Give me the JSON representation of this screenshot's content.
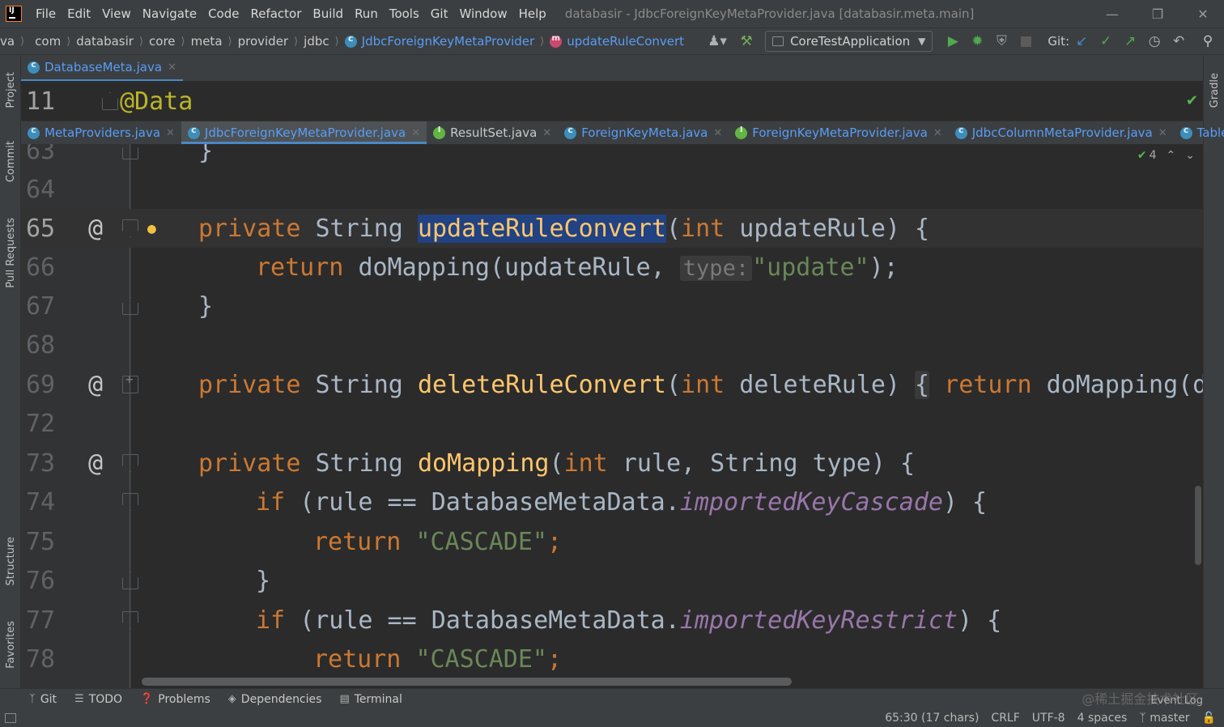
{
  "menubar": {
    "items": [
      "File",
      "Edit",
      "View",
      "Navigate",
      "Code",
      "Refactor",
      "Build",
      "Run",
      "Tools",
      "Git",
      "Window",
      "Help"
    ],
    "window_title": "databasir - JdbcForeignKeyMetaProvider.java [databasir.meta.main]"
  },
  "navbar": {
    "crumbs": [
      "va",
      "com",
      "databasir",
      "core",
      "meta",
      "provider",
      "jdbc"
    ],
    "class_crumb": "JdbcForeignKeyMetaProvider",
    "method_crumb": "updateRuleConvert",
    "run_config": "CoreTestApplication",
    "git_label": "Git:"
  },
  "pinned_tab": {
    "label": "DatabaseMeta.java"
  },
  "sticky": {
    "line_number": "11",
    "text": "@Data"
  },
  "tabs": [
    {
      "label": "MetaProviders.java",
      "icon": "class-icon"
    },
    {
      "label": "JdbcForeignKeyMetaProvider.java",
      "icon": "class-icon",
      "active": true
    },
    {
      "label": "ResultSet.java",
      "icon": "interface-icon"
    },
    {
      "label": "ForeignKeyMeta.java",
      "icon": "class-icon"
    },
    {
      "label": "ForeignKeyMetaProvider.java",
      "icon": "interface-icon"
    },
    {
      "label": "JdbcColumnMetaProvider.java",
      "icon": "class-icon"
    },
    {
      "label": "Table(",
      "icon": "class-icon"
    }
  ],
  "inspection": {
    "count": "4"
  },
  "editor": {
    "lines": [
      {
        "n": "63",
        "text": "}"
      },
      {
        "n": "64",
        "text": ""
      },
      {
        "n": "65",
        "kw": "private ",
        "type": "String ",
        "sel": "updateRuleConvert",
        "rest1": "(",
        "kw2": "int",
        "rest2": " updateRule) {"
      },
      {
        "n": "66",
        "kw": "return ",
        "rest1": "doMapping(updateRule, ",
        "hint": "type:",
        "str": "\"update\"",
        "rest2": ");"
      },
      {
        "n": "67",
        "text": "}"
      },
      {
        "n": "68",
        "text": ""
      },
      {
        "n": "69",
        "kw": "private ",
        "type": "String ",
        "fn": "deleteRuleConvert",
        "rest1": "(",
        "kw2": "int",
        "rest2": " deleteRule) ",
        "brace": "{",
        "kw3": " return ",
        "rest3": "doMapping(de"
      },
      {
        "n": "72",
        "text": ""
      },
      {
        "n": "73",
        "kw": "private ",
        "type": "String ",
        "fn": "doMapping",
        "rest1": "(",
        "kw2": "int",
        "rest2": " rule, String type) {"
      },
      {
        "n": "74",
        "kw": "if ",
        "rest1": "(rule == DatabaseMetaData.",
        "fld": "importedKeyCascade",
        "rest2": ") {"
      },
      {
        "n": "75",
        "kw": "return ",
        "str": "\"CASCADE\"",
        "rest2": ";"
      },
      {
        "n": "76",
        "text": "}"
      },
      {
        "n": "77",
        "kw": "if ",
        "rest1": "(rule == DatabaseMetaData.",
        "fld": "importedKeyRestrict",
        "rest2": ") {"
      },
      {
        "n": "78",
        "kw": "return ",
        "str": "\"CASCADE\"",
        "rest2": ";"
      }
    ]
  },
  "tool_tabs": [
    "Git",
    "TODO",
    "Problems",
    "Dependencies",
    "Terminal"
  ],
  "left_stripe": [
    "Project",
    "Commit",
    "Pull Requests",
    "Structure",
    "Favorites"
  ],
  "right_stripe": [
    "Gradle"
  ],
  "status": {
    "position": "65:30 (17 chars)",
    "line_sep": "CRLF",
    "encoding": "UTF-8",
    "indent": "4 spaces",
    "branch": "master"
  },
  "watermark": "@稀土掘金技术社区",
  "event_log": "Event Log",
  "colors": {
    "keyword": "#cc7832",
    "function": "#ffc66d",
    "string": "#6a8759",
    "field": "#9876aa",
    "selection": "#214283",
    "accent": "#589df6"
  }
}
